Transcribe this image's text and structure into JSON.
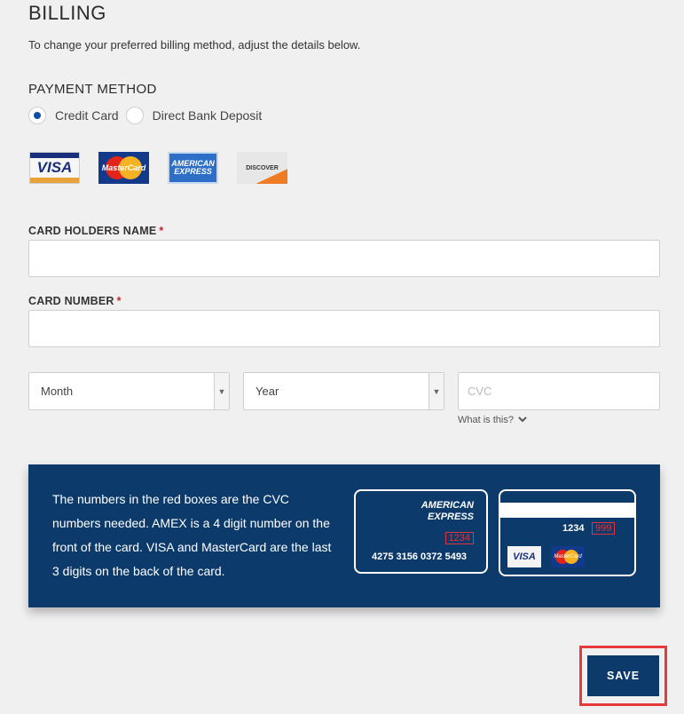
{
  "header": {
    "title": "BILLING",
    "subtitle": "To change your preferred billing method, adjust the details below."
  },
  "payment": {
    "section_label": "PAYMENT METHOD",
    "options": [
      {
        "label": "Credit Card",
        "selected": true
      },
      {
        "label": "Direct Bank Deposit",
        "selected": false
      }
    ],
    "card_logos": [
      {
        "name": "VISA",
        "icon": "visa-logo"
      },
      {
        "name": "MasterCard",
        "icon": "mastercard-logo"
      },
      {
        "name": "AMERICAN EXPRESS",
        "icon": "amex-logo"
      },
      {
        "name": "DISCOVER",
        "icon": "discover-logo"
      }
    ]
  },
  "form": {
    "card_holders_name_label": "CARD HOLDERS NAME",
    "card_number_label": "CARD NUMBER",
    "required_mark": "*",
    "month_value": "Month",
    "year_value": "Year",
    "cvc_placeholder": "CVC",
    "what_is_this": "What is this?"
  },
  "info": {
    "text": "The numbers in the red boxes are the CVC numbers needed. AMEX is a 4 digit number on the front of the card. VISA and MasterCard are the last 3 digits on the back of the card.",
    "amex_logo_line1": "AMERICAN",
    "amex_logo_line2": "EXPRESS",
    "amex_cvc": "1234",
    "amex_number": "4275 3156 0372 5493",
    "back_number": "1234",
    "back_cvc": "999",
    "visa_mini": "VISA",
    "mastercard_mini": "MasterCard",
    "background_color": "#0b3a6b",
    "highlight_color": "#e0343a"
  },
  "actions": {
    "save_label": "SAVE",
    "highlight_border_color": "#e83a3a"
  }
}
